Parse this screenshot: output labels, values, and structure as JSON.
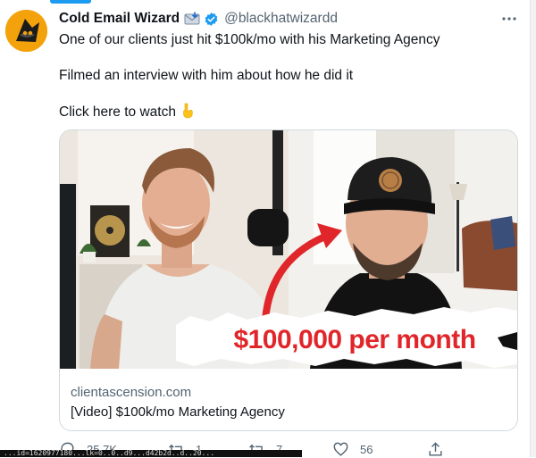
{
  "tweet": {
    "author_name": "Cold Email Wizard",
    "handle": "@blackhatwizardd",
    "text_line1": "One of our clients just hit $100k/mo with his Marketing Agency",
    "text_line2": "Filmed an interview with him about how he did it",
    "text_line3": "Click here to watch",
    "icons": {
      "author": "envelope-emoji-icon",
      "verified": "verified-badge-icon",
      "pointing": "pointing-down-emoji-icon",
      "more": "more-options-icon"
    }
  },
  "card": {
    "thumbnail_caption": "$100,000 per month",
    "domain": "clientascension.com",
    "title": "[Video] $100k/mo Marketing Agency"
  },
  "actions": {
    "reply_count": "25.7K",
    "retweet_count": "1",
    "quote_count": "7",
    "like_count": "56"
  },
  "status_bar": {
    "url_text": "...id=1620977180...lk=0..0..d9...d42b2d..d..20..."
  },
  "colors": {
    "accent": "#1d9bf0",
    "caption_red": "#e0262a",
    "text_secondary": "#536471"
  }
}
